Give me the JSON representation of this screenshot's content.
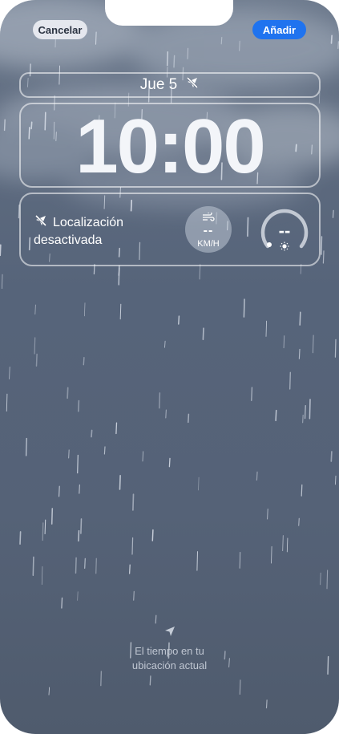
{
  "header": {
    "cancel_label": "Cancelar",
    "add_label": "Añadir"
  },
  "lock_screen": {
    "date": "Jue 5",
    "time": "10:00"
  },
  "widget": {
    "location_line1": "Localización",
    "location_line2": "desactivada",
    "wind_value": "--",
    "wind_unit": "KM/H",
    "gauge_value": "--"
  },
  "footer": {
    "line1": "El tiempo en tu",
    "line2": "ubicación actual"
  },
  "colors": {
    "accent": "#1f73ef",
    "background_top": "#6d7a8d",
    "background_bottom": "#4f5b6d"
  },
  "icons": {
    "location_off": "location-slash-icon",
    "wind": "wind-icon",
    "sun": "sun-icon",
    "location_arrow": "location-arrow-icon"
  }
}
